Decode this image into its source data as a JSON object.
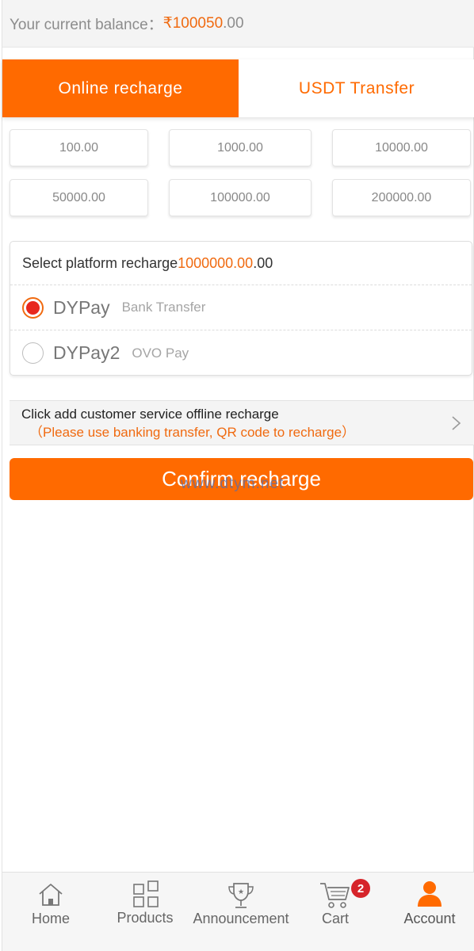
{
  "balance": {
    "label": "Your current balance：",
    "currency": "₹",
    "amount": "100050",
    "decimals": ".00"
  },
  "tabs": [
    {
      "label": "Online recharge",
      "active": true
    },
    {
      "label": "USDT Transfer",
      "active": false
    }
  ],
  "amounts": [
    "100.00",
    "1000.00",
    "10000.00",
    "50000.00",
    "100000.00",
    "200000.00"
  ],
  "platform": {
    "title_prefix": "Select platform recharge ",
    "title_amount": "1000000.00",
    "title_suffix": ".00",
    "options": [
      {
        "name": "DYPay",
        "desc": "Bank Transfer",
        "selected": true
      },
      {
        "name": "DYPay2",
        "desc": "OVO Pay",
        "selected": false
      }
    ]
  },
  "offline": {
    "line1": "Click add customer service offline recharge",
    "line2": "（Please use banking transfer, QR code to recharge）",
    "icon": "chevron-right-icon"
  },
  "confirm": {
    "label": "Confirm recharge"
  },
  "watermark": "www.dtym.net",
  "nav": [
    {
      "label": "Home",
      "icon": "home-icon"
    },
    {
      "label": "Products",
      "icon": "grid-icon"
    },
    {
      "label": "Announcement",
      "icon": "trophy-icon"
    },
    {
      "label": "Cart",
      "icon": "cart-icon",
      "badge": "2"
    },
    {
      "label": "Account",
      "icon": "user-icon",
      "active": true
    }
  ],
  "colors": {
    "accent": "#ff6a00",
    "badge": "#d6242a",
    "radio": "#e8281e"
  }
}
